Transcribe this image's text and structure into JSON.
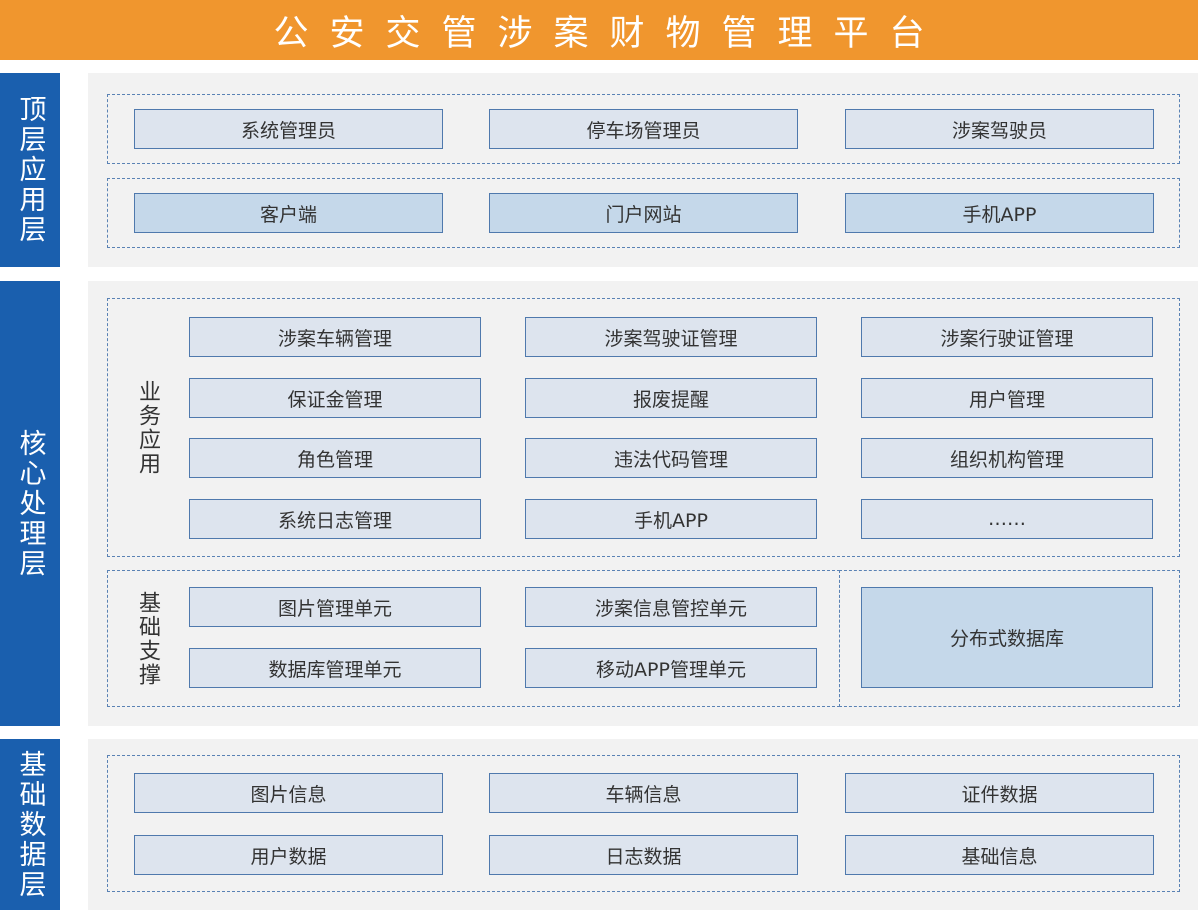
{
  "title": "公安交管涉案财物管理平台",
  "layers": {
    "top": {
      "label": "顶层应用层",
      "users": [
        "系统管理员",
        "停车场管理员",
        "涉案驾驶员"
      ],
      "clients": [
        "客户端",
        "门户网站",
        "手机APP"
      ]
    },
    "core": {
      "label": "核心处理层",
      "business": {
        "label": "业务应用",
        "items": [
          "涉案车辆管理",
          "涉案驾驶证管理",
          "涉案行驶证管理",
          "保证金管理",
          "报废提醒",
          "用户管理",
          "角色管理",
          "违法代码管理",
          "组织机构管理",
          "系统日志管理",
          "手机APP",
          "……"
        ]
      },
      "support": {
        "label": "基础支撑",
        "items": [
          "图片管理单元",
          "涉案信息管控单元",
          "数据库管理单元",
          "移动APP管理单元"
        ],
        "database": "分布式数据库"
      }
    },
    "data": {
      "label": "基础数据层",
      "items": [
        "图片信息",
        "车辆信息",
        "证件数据",
        "用户数据",
        "日志数据",
        "基础信息"
      ]
    }
  },
  "colors": {
    "title_bg": "#f0962e",
    "layer_label_bg": "#1a5fae",
    "panel_bg": "#f2f2f2",
    "module_bg": "#dde4ee",
    "module_accent_bg": "#c5d8ea",
    "module_border": "#4f79ad"
  }
}
